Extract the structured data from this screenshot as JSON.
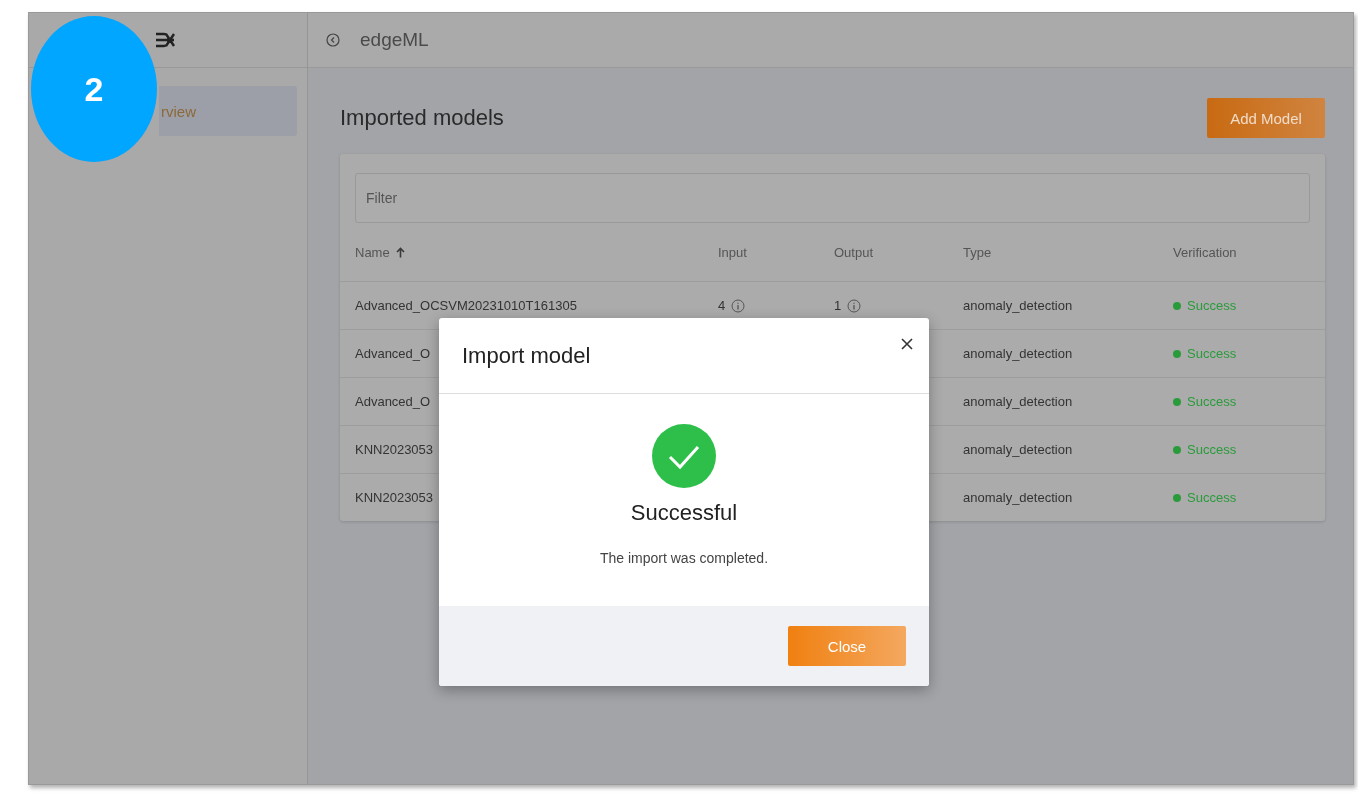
{
  "step_badge": "2",
  "app": {
    "title": "edgeML"
  },
  "sidebar": {
    "items": [
      {
        "label": "rview",
        "selected": true
      }
    ]
  },
  "page": {
    "title": "Imported models",
    "add_button": "Add Model"
  },
  "filter": {
    "placeholder": "Filter"
  },
  "table": {
    "columns": [
      {
        "label": "Name",
        "sorted": true
      },
      {
        "label": "Input",
        "sorted": false
      },
      {
        "label": "Output",
        "sorted": false
      },
      {
        "label": "Type",
        "sorted": false
      },
      {
        "label": "Verification",
        "sorted": false
      }
    ],
    "rows": [
      {
        "name": "Advanced_OCSVM20231010T161305",
        "input": "4",
        "output": "1",
        "type": "anomaly_detection",
        "verification": "Success",
        "color": "#2a9b3a"
      },
      {
        "name": "Advanced_O",
        "type": "anomaly_detection",
        "verification": "Success",
        "color": "#2a9b3a"
      },
      {
        "name": "Advanced_O",
        "type": "anomaly_detection",
        "verification": "Success",
        "color": "#2a9b3a"
      },
      {
        "name": "KNN2023053",
        "type": "anomaly_detection",
        "verification": "Success",
        "color": "#2a9b3a"
      },
      {
        "name": "KNN2023053",
        "type": "anomaly_detection",
        "verification": "Success",
        "color": "#2a9b3a"
      }
    ]
  },
  "dialog": {
    "title": "Import model",
    "heading": "Successful",
    "message": "The import was completed.",
    "button": "Close"
  }
}
